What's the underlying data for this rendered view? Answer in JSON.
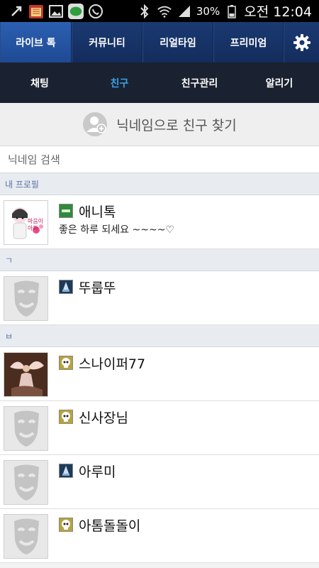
{
  "status_bar": {
    "battery_percent": "30%",
    "time": "오전 12:04",
    "icons": [
      "usb-icon",
      "calendar-icon",
      "gallery-icon",
      "messenger-icon",
      "call-icon",
      "bluetooth-icon",
      "wifi-icon",
      "signal-icon",
      "battery-icon"
    ]
  },
  "top_nav": {
    "tabs": [
      {
        "label": "라이브 톡",
        "active": true
      },
      {
        "label": "커뮤니티",
        "active": false
      },
      {
        "label": "리얼타임",
        "active": false
      },
      {
        "label": "프리미엄",
        "active": false
      }
    ],
    "settings_icon": "gear-icon"
  },
  "sub_nav": {
    "tabs": [
      {
        "label": "채팅",
        "active": false
      },
      {
        "label": "친구",
        "active": true
      },
      {
        "label": "친구관리",
        "active": false
      },
      {
        "label": "알리기",
        "active": false
      }
    ]
  },
  "find_friend": {
    "label": "닉네임으로 친구 찾기",
    "icon": "add-user-icon"
  },
  "search": {
    "placeholder": "닉네임 검색",
    "value": ""
  },
  "sections": [
    {
      "header": "내 프로필",
      "items": [
        {
          "nickname": "애니톡",
          "status": "좋은 하루 되세요 ~~~~♡",
          "avatar": "sticker-photo",
          "level_icon": "green-level-icon"
        }
      ]
    },
    {
      "header": "ㄱ",
      "items": [
        {
          "nickname": "뚜룹뚜",
          "status": "",
          "avatar": "default-mask",
          "level_icon": "blue-level-icon"
        }
      ]
    },
    {
      "header": "ㅂ",
      "items": [
        {
          "nickname": "스나이퍼77",
          "status": "",
          "avatar": "fairy-photo",
          "level_icon": "skull-level-icon"
        },
        {
          "nickname": "신사장님",
          "status": "",
          "avatar": "default-mask",
          "level_icon": "skull-level-icon"
        },
        {
          "nickname": "아루미",
          "status": "",
          "avatar": "default-mask",
          "level_icon": "blue-level-icon"
        },
        {
          "nickname": "아톰돌돌이",
          "status": "",
          "avatar": "default-mask",
          "level_icon": "skull-level-icon"
        }
      ]
    }
  ],
  "colors": {
    "top_nav_bg": "#163366",
    "top_nav_active": "#2a5aa8",
    "sub_nav_bg": "#1a2130",
    "sub_nav_active_text": "#3aa3e8",
    "section_header_text": "#5a76a8"
  }
}
